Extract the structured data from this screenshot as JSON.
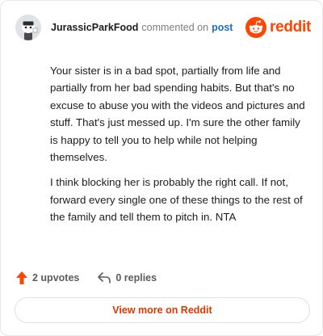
{
  "header": {
    "author": "JurassicParkFood",
    "action_text": "commented on",
    "post_link": "post",
    "brand": "reddit"
  },
  "comment": {
    "paragraphs": [
      "Your sister is in a bad spot, partially from life and partially from her bad spending habits. But that's no excuse to abuse you with the videos and pictures and stuff. That's just messed up. I'm sure the other family is happy to tell you to help while not helping themselves.",
      "I think blocking her is probably the right call. If not, forward every single one of these things to the rest of the family and tell them to pitch in. NTA"
    ]
  },
  "actions": {
    "upvotes": "2 upvotes",
    "replies": "0 replies"
  },
  "footer": {
    "view_more": "View more on Reddit"
  },
  "colors": {
    "brand": "#ff4500",
    "link": "#1b6ad8",
    "upvote": "#ff4500"
  },
  "icons": {
    "avatar": "snoo-avatar-icon",
    "logo": "reddit-logo-icon",
    "upvote": "upvote-arrow-icon",
    "reply": "reply-arrow-icon"
  }
}
